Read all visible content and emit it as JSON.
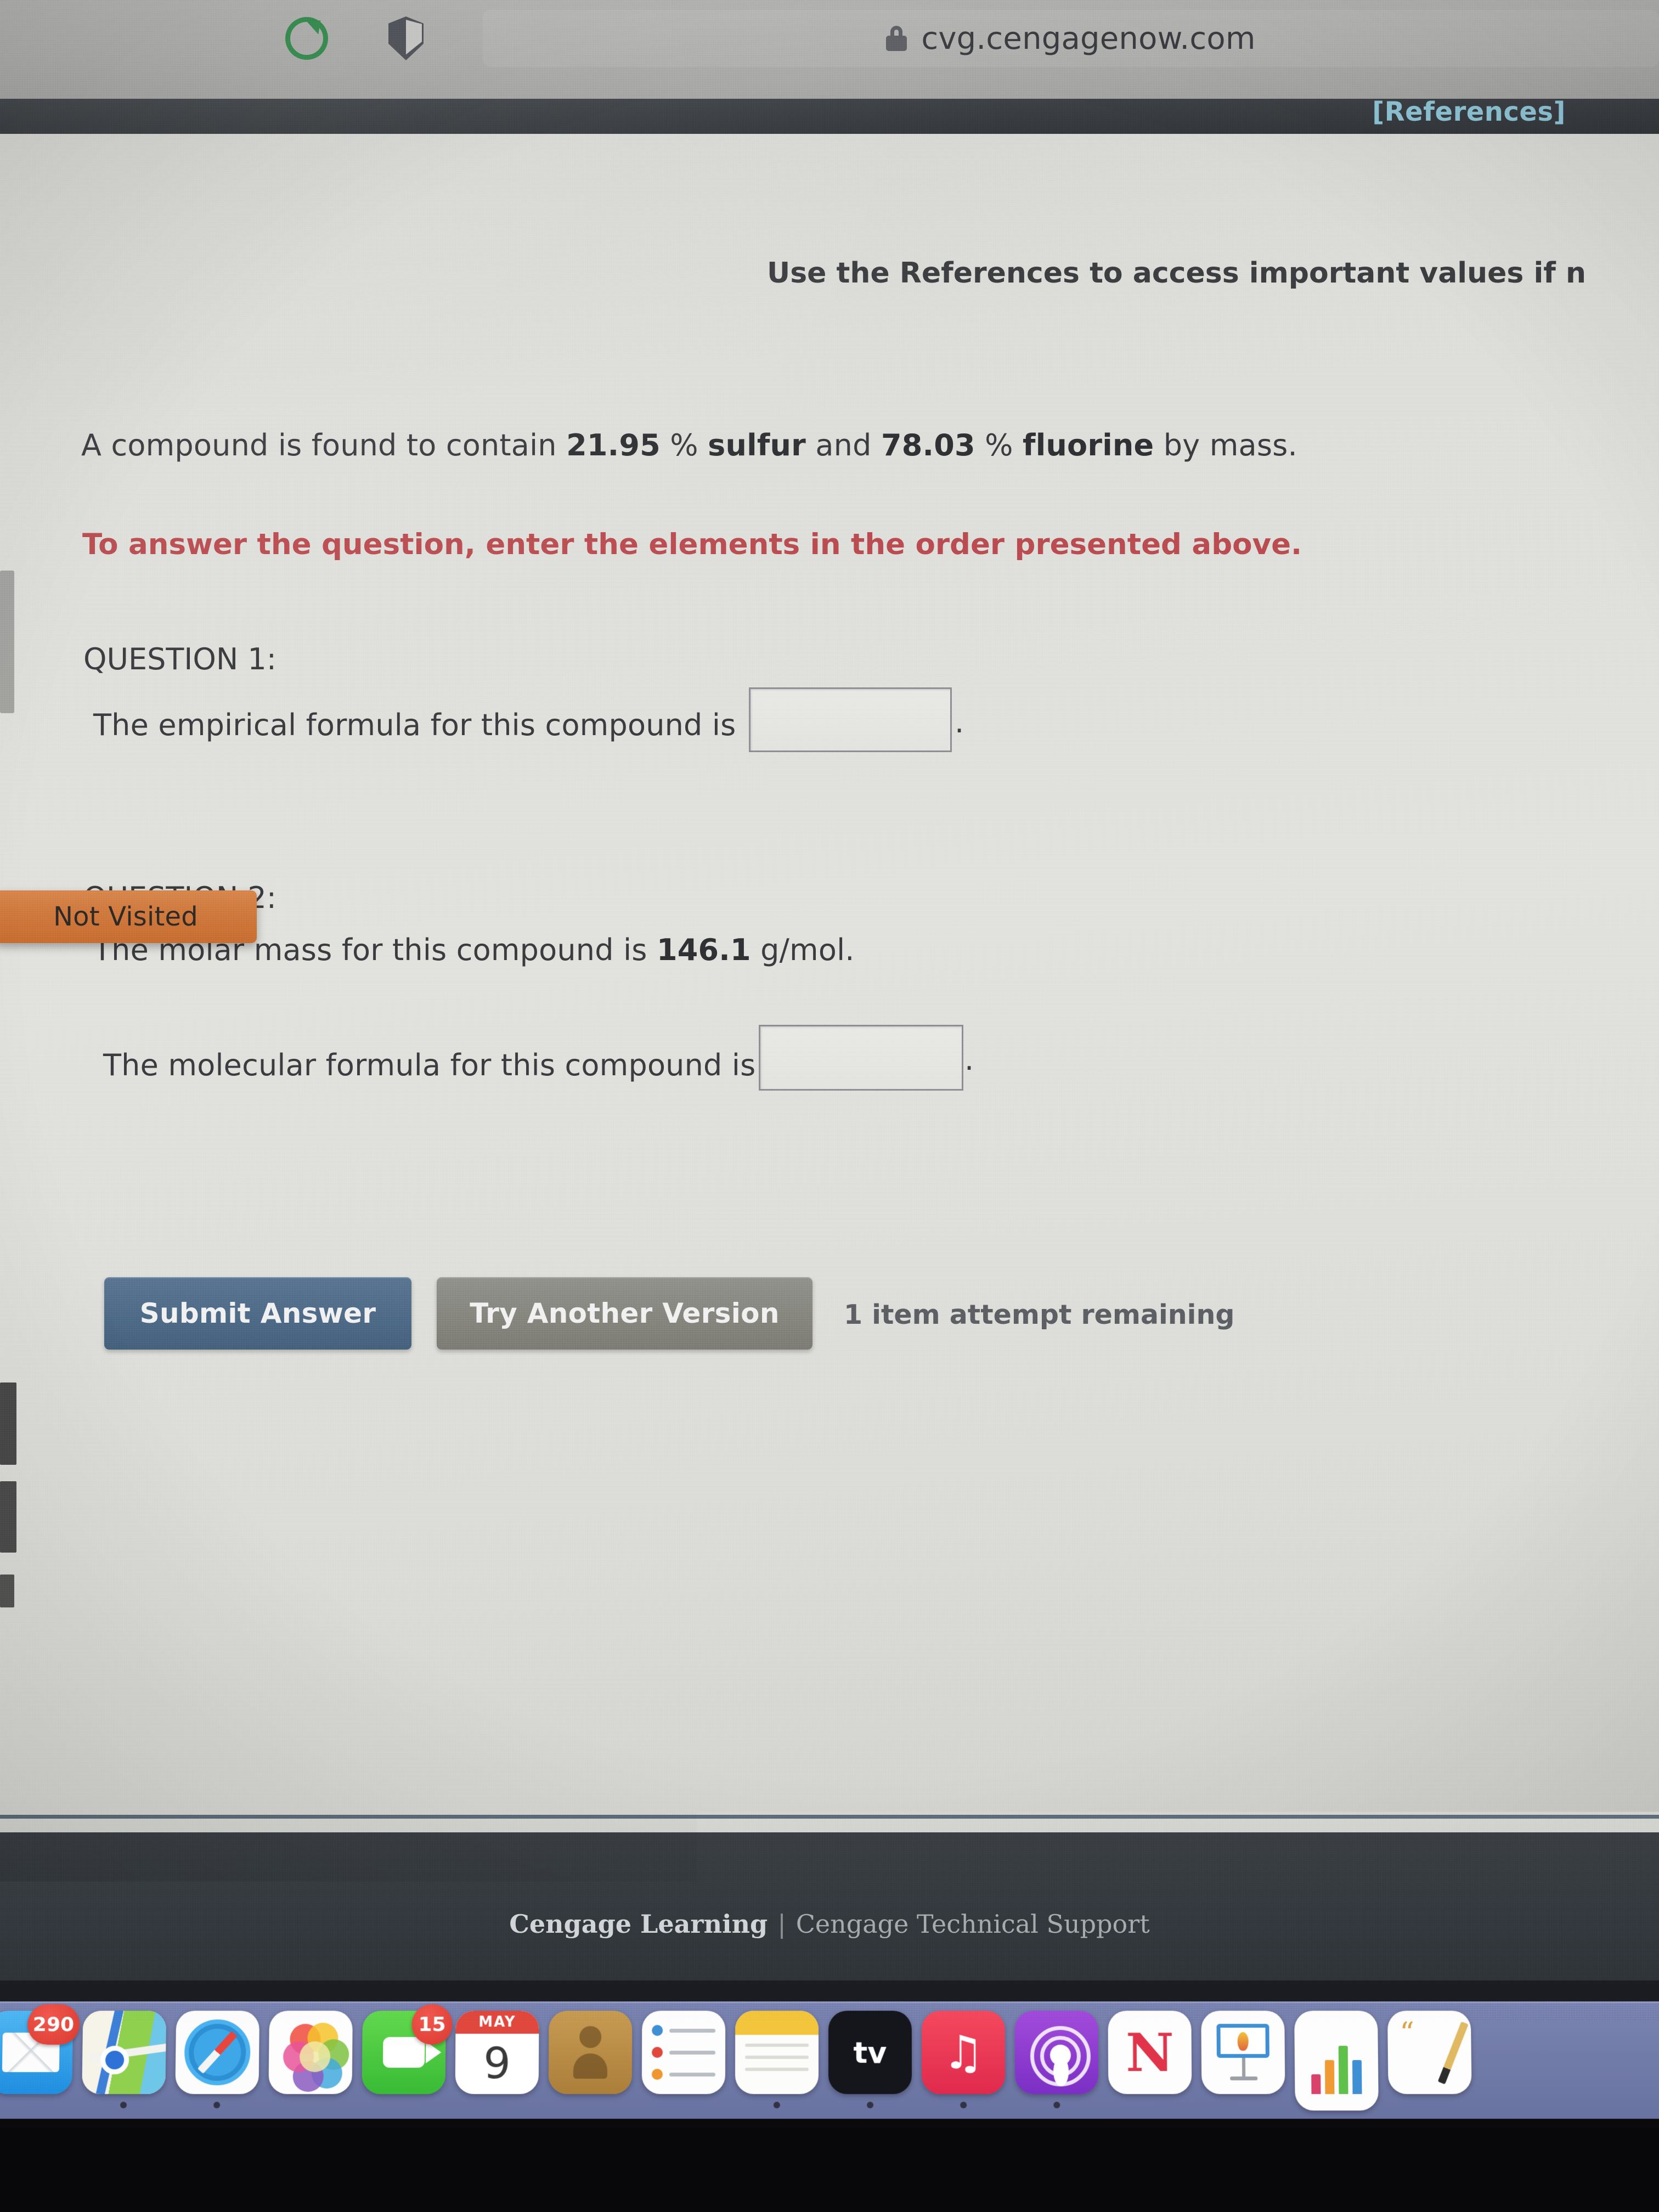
{
  "browser": {
    "url": "cvg.cengagenow.com",
    "lock_icon": "lock-icon",
    "reload_icon": "reload-icon",
    "shield_icon": "shield-icon"
  },
  "page": {
    "references_link": "[References]",
    "reference_instruction": "Use the References to access important values if n",
    "question_stem": {
      "before_pct1": "A compound is found to contain ",
      "pct1": "21.95",
      "mid1": " % ",
      "element1": "sulfur",
      "mid2": " and ",
      "pct2": "78.03",
      "mid3": " % ",
      "element2": "fluorine",
      "after": " by mass."
    },
    "red_instruction": "To answer the question, enter the elements in the order presented above.",
    "question1": {
      "label": "QUESTION 1:",
      "prompt": "The empirical formula for this compound is",
      "answer_value": "",
      "placeholder": "",
      "trailing_period": "."
    },
    "question2": {
      "label": "QUESTION 2:",
      "molar_mass_before": "The molar mass for this compound is ",
      "molar_mass_value": "146.1",
      "molar_mass_after": " g/mol.",
      "prompt": "The molecular formula for this compound is",
      "answer_value": "",
      "placeholder": "",
      "trailing_period": "."
    },
    "tooltip": {
      "label": "Not Visited",
      "color": "#cf7a3e"
    },
    "actions": {
      "submit_label": "Submit Answer",
      "try_another_label": "Try Another Version",
      "attempts_text": "1 item attempt remaining",
      "submit_color": "#4e6b88",
      "try_another_color": "#87877f"
    }
  },
  "footer": {
    "brand": "Cengage Learning",
    "separator": "|",
    "support": "Cengage Technical Support"
  },
  "dock": {
    "items": [
      {
        "name": "mail",
        "badge": "290"
      },
      {
        "name": "maps",
        "badge": ""
      },
      {
        "name": "safari",
        "badge": ""
      },
      {
        "name": "photos",
        "badge": ""
      },
      {
        "name": "facetime",
        "badge": "15"
      },
      {
        "name": "calendar",
        "badge": "",
        "month": "MAY",
        "day": "9"
      },
      {
        "name": "contacts",
        "badge": ""
      },
      {
        "name": "reminders",
        "badge": ""
      },
      {
        "name": "notes",
        "badge": ""
      },
      {
        "name": "apple-tv",
        "badge": "",
        "label": "tv"
      },
      {
        "name": "music",
        "badge": "",
        "glyph": "♫"
      },
      {
        "name": "podcasts",
        "badge": ""
      },
      {
        "name": "news",
        "badge": "",
        "glyph": "N"
      },
      {
        "name": "keynote",
        "badge": ""
      },
      {
        "name": "numbers",
        "badge": ""
      },
      {
        "name": "pages",
        "badge": ""
      }
    ]
  }
}
